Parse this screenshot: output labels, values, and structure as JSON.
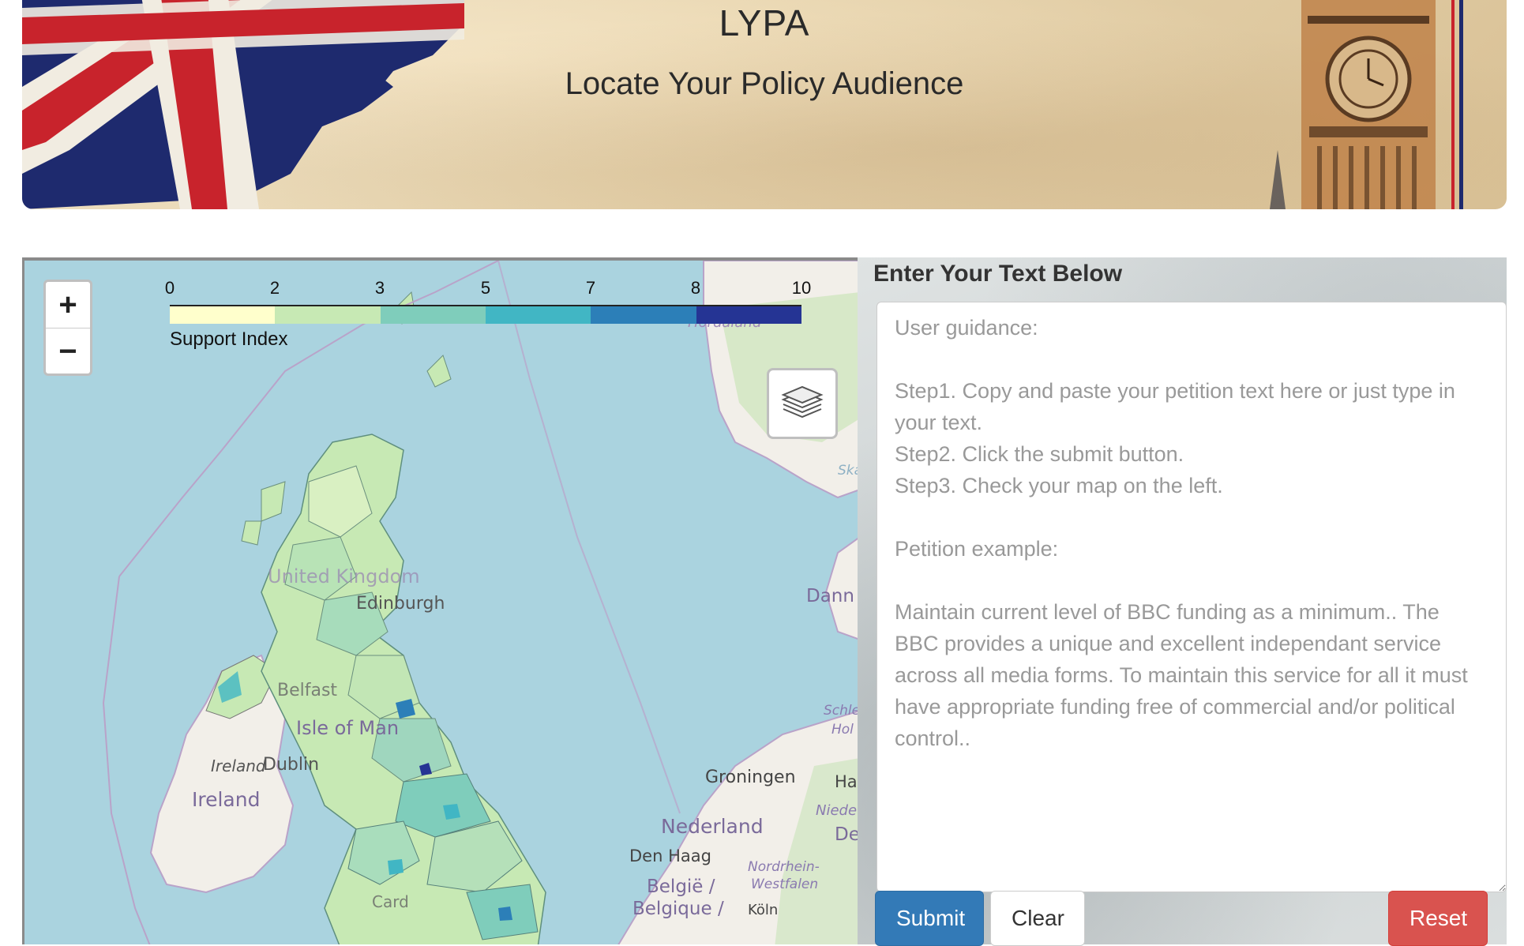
{
  "banner": {
    "title": "LYPA",
    "subtitle": "Locate Your Policy Audience"
  },
  "map": {
    "zoom_in": "+",
    "zoom_out": "−",
    "legend": {
      "ticks": [
        "0",
        "2",
        "3",
        "5",
        "7",
        "8",
        "10"
      ],
      "colors": [
        "#ffffcc",
        "#c7e9b4",
        "#7fcdbb",
        "#41b6c4",
        "#2c7fb8",
        "#253494"
      ],
      "caption": "Support Index"
    },
    "labels": {
      "hordaland": "Hordaland",
      "ska": "Ska",
      "dann": "Dann",
      "united_kingdom": "United Kingdom",
      "edinburgh": "Edinburgh",
      "belfast": "Belfast",
      "isle_of_man": "Isle of Man",
      "ireland_dublin": "Ireland",
      "dublin": "Dublin",
      "ireland": "Ireland",
      "schle": "Schle",
      "hol": "Hol",
      "groningen": "Groningen",
      "ha": "Ha",
      "niede": "Niede",
      "de": "De",
      "nederland": "Nederland",
      "den_haag": "Den Haag",
      "nordrhein": "Nordrhein-",
      "westfalen": "Westfalen",
      "belgie": "België /",
      "belgique": "Belgique /",
      "koln": "Köln",
      "card": "Card"
    }
  },
  "form": {
    "heading": "Enter Your Text Below",
    "textarea_placeholder": "User guidance:\n\nStep1. Copy and paste your petition text here or just type in your text.\nStep2. Click the submit button.\nStep3. Check your map on the left.\n\nPetition example:\n\nMaintain current level of BBC funding as a minimum.. The BBC provides a unique and excellent independant service across all media forms. To maintain this service for all it must have appropriate funding free of commercial and/or political control..",
    "submit_label": "Submit",
    "clear_label": "Clear",
    "reset_label": "Reset"
  }
}
